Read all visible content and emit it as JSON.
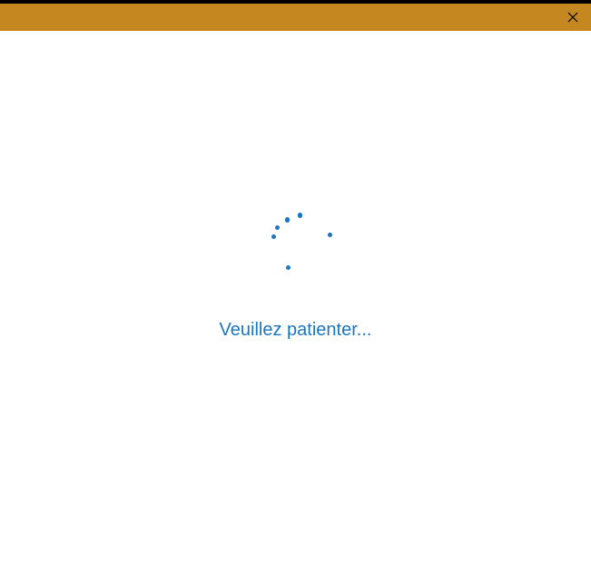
{
  "titlebar": {
    "close_icon": "close"
  },
  "main": {
    "loading_message": "Veuillez patienter...",
    "spinner_color": "#1976c2"
  }
}
